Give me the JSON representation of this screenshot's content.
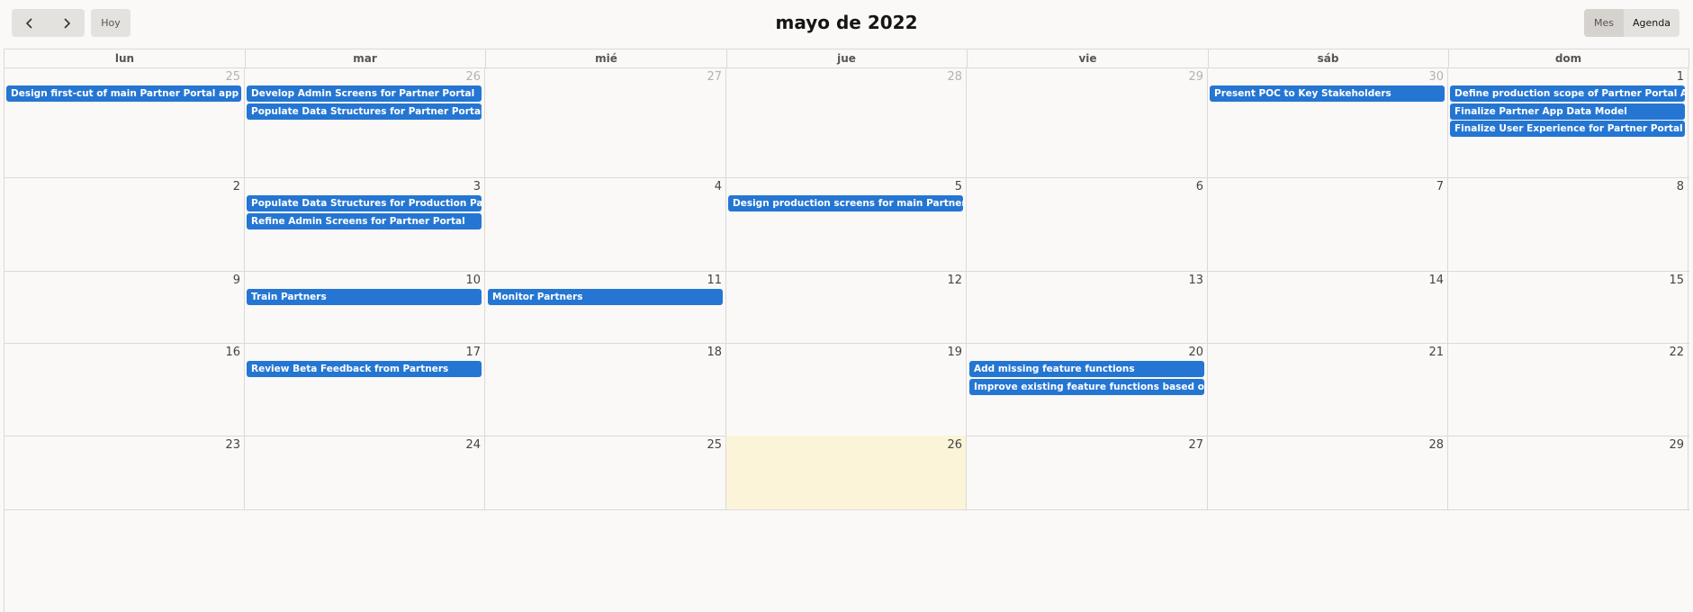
{
  "toolbar": {
    "prev_icon": "chevron-left-icon",
    "next_icon": "chevron-right-icon",
    "today_label": "Hoy",
    "title": "mayo de 2022",
    "view_month_label": "Mes",
    "view_agenda_label": "Agenda"
  },
  "weekdays": [
    "lun",
    "mar",
    "mié",
    "jue",
    "vie",
    "sáb",
    "dom"
  ],
  "weeks": [
    {
      "days": [
        {
          "num": "25",
          "other": true,
          "events": [
            "Design first-cut of main Partner Portal app"
          ]
        },
        {
          "num": "26",
          "other": true,
          "events": [
            "Develop Admin Screens for Partner Portal",
            "Populate Data Structures for Partner Portal"
          ]
        },
        {
          "num": "27",
          "other": true,
          "events": []
        },
        {
          "num": "28",
          "other": true,
          "events": []
        },
        {
          "num": "29",
          "other": true,
          "events": []
        },
        {
          "num": "30",
          "other": true,
          "events": [
            "Present POC to Key Stakeholders"
          ]
        },
        {
          "num": "1",
          "other": false,
          "events": [
            "Define production scope of Partner Portal App.",
            "Finalize Partner App Data Model",
            "Finalize User Experience for Partner Portal app"
          ]
        }
      ]
    },
    {
      "days": [
        {
          "num": "2",
          "events": []
        },
        {
          "num": "3",
          "events": [
            "Populate Data Structures for Production Partner Portal",
            "Refine Admin Screens for Partner Portal"
          ]
        },
        {
          "num": "4",
          "events": []
        },
        {
          "num": "5",
          "events": [
            "Design production screens for main Partner Portal app"
          ]
        },
        {
          "num": "6",
          "events": []
        },
        {
          "num": "7",
          "events": []
        },
        {
          "num": "8",
          "events": []
        }
      ]
    },
    {
      "days": [
        {
          "num": "9",
          "events": []
        },
        {
          "num": "10",
          "events": [
            "Train Partners"
          ]
        },
        {
          "num": "11",
          "events": [
            "Monitor Partners"
          ]
        },
        {
          "num": "12",
          "events": []
        },
        {
          "num": "13",
          "events": []
        },
        {
          "num": "14",
          "events": []
        },
        {
          "num": "15",
          "events": []
        }
      ]
    },
    {
      "days": [
        {
          "num": "16",
          "events": []
        },
        {
          "num": "17",
          "events": [
            "Review Beta Feedback from Partners"
          ]
        },
        {
          "num": "18",
          "events": []
        },
        {
          "num": "19",
          "events": []
        },
        {
          "num": "20",
          "events": [
            "Add missing feature functions",
            "Improve existing feature functions based on feedback"
          ]
        },
        {
          "num": "21",
          "events": []
        },
        {
          "num": "22",
          "events": []
        }
      ]
    },
    {
      "days": [
        {
          "num": "23",
          "events": []
        },
        {
          "num": "24",
          "events": []
        },
        {
          "num": "25",
          "events": []
        },
        {
          "num": "26",
          "today": true,
          "events": []
        },
        {
          "num": "27",
          "events": []
        },
        {
          "num": "28",
          "events": []
        },
        {
          "num": "29",
          "events": []
        }
      ]
    }
  ],
  "colors": {
    "event": "#2576d2",
    "today": "#fcf4d8",
    "background": "#faf9f8"
  }
}
